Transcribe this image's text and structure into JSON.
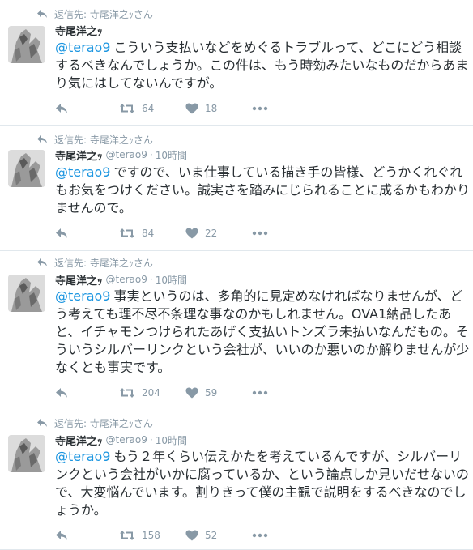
{
  "tweets": [
    {
      "context": "返信先: 寺尾洋之ｯさん",
      "name": "寺尾洋之ｯ",
      "screen_name": "",
      "separator": "",
      "time": "",
      "mention": "@terao9",
      "text": "こういう支払いなどをめぐるトラブルって、どこにどう相談するべきなんでしょうか。この件は、もう時効みたいなものだからあまり気にはしてないんですが。",
      "retweets": "64",
      "likes": "18"
    },
    {
      "context": "返信先: 寺尾洋之ｯさん",
      "name": "寺尾洋之ｯ",
      "screen_name": "@terao9",
      "separator": "·",
      "time": "10時間",
      "mention": "@terao9",
      "text": "ですので、いま仕事している描き手の皆様、どうかくれぐれもお気をつけください。誠実さを踏みにじられることに成るかもわかりませんので。",
      "retweets": "84",
      "likes": "22"
    },
    {
      "context": "返信先: 寺尾洋之ｯさん",
      "name": "寺尾洋之ｯ",
      "screen_name": "@terao9",
      "separator": "·",
      "time": "10時間",
      "mention": "@terao9",
      "text": "事実というのは、多角的に見定めなければなりませんが、どう考えても理不尽不条理な事なのかもしれません。OVA1納品したあと、イチャモンつけられたあげく支払いトンズラ未払いなんだもの。そういうシルバーリンクという会社が、いいのか悪いのか解りませんが少なくとも事実です。",
      "retweets": "204",
      "likes": "59"
    },
    {
      "context": "返信先: 寺尾洋之ｯさん",
      "name": "寺尾洋之ｯ",
      "screen_name": "@terao9",
      "separator": "·",
      "time": "10時間",
      "mention": "@terao9",
      "text": "もう２年くらい伝えかたを考えているんですが、シルバーリンクという会社がいかに腐っているか、という論点しか見いだせないので、大変悩んでいます。割りきって僕の主観で説明をするべきなのでしょうか。",
      "retweets": "158",
      "likes": "52"
    }
  ],
  "icons": {
    "context": "reply-arrow-icon",
    "reply": "reply-icon",
    "retweet": "retweet-icon",
    "like": "heart-icon",
    "more": "more-dots-icon"
  },
  "colors": {
    "mention": "#1b95e0",
    "muted": "#8899a6",
    "divider": "#e1e8ed"
  }
}
